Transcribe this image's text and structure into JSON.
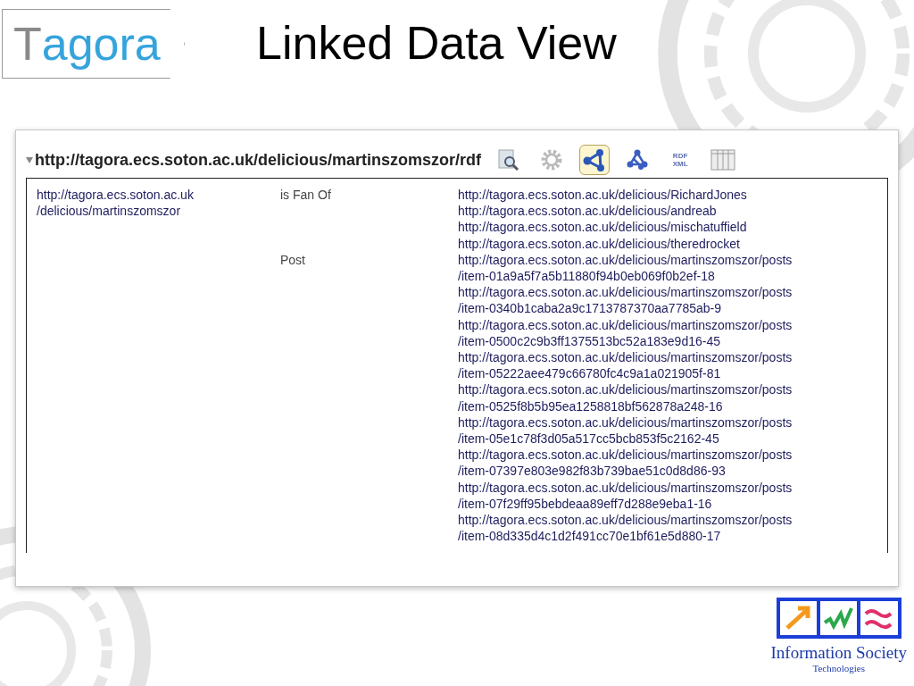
{
  "logo": {
    "text": "Tagora"
  },
  "title": "Linked Data View",
  "panel": {
    "expanded": true,
    "url": "http://tagora.ecs.soton.ac.uk/delicious/martinszomszor/rdf",
    "tools": [
      {
        "kind": "search",
        "selected": false
      },
      {
        "kind": "gear",
        "selected": false
      },
      {
        "kind": "graph",
        "selected": true
      },
      {
        "kind": "network",
        "selected": false
      },
      {
        "kind": "rdf",
        "label": "RDF\nXML",
        "selected": false
      },
      {
        "kind": "table",
        "selected": false
      }
    ],
    "subject": "http://tagora.ecs.soton.ac.uk\n/delicious/martinszomszor",
    "properties": [
      {
        "label": "is Fan Of",
        "values": [
          "http://tagora.ecs.soton.ac.uk/delicious/RichardJones",
          "http://tagora.ecs.soton.ac.uk/delicious/andreab",
          "http://tagora.ecs.soton.ac.uk/delicious/mischatuffield",
          "http://tagora.ecs.soton.ac.uk/delicious/theredrocket"
        ]
      },
      {
        "label": "Post",
        "values": [
          "http://tagora.ecs.soton.ac.uk/delicious/martinszomszor/posts\n/item-01a9a5f7a5b11880f94b0eb069f0b2ef-18",
          "http://tagora.ecs.soton.ac.uk/delicious/martinszomszor/posts\n/item-0340b1caba2a9c1713787370aa7785ab-9",
          "http://tagora.ecs.soton.ac.uk/delicious/martinszomszor/posts\n/item-0500c2c9b3ff1375513bc52a183e9d16-45",
          "http://tagora.ecs.soton.ac.uk/delicious/martinszomszor/posts\n/item-05222aee479c66780fc4c9a1a021905f-81",
          "http://tagora.ecs.soton.ac.uk/delicious/martinszomszor/posts\n/item-0525f8b5b95ea1258818bf562878a248-16",
          "http://tagora.ecs.soton.ac.uk/delicious/martinszomszor/posts\n/item-05e1c78f3d05a517cc5bcb853f5c2162-45",
          "http://tagora.ecs.soton.ac.uk/delicious/martinszomszor/posts\n/item-07397e803e982f83b739bae51c0d8d86-93",
          "http://tagora.ecs.soton.ac.uk/delicious/martinszomszor/posts\n/item-07f29ff95bebdeaa89eff7d288e9eba1-16",
          "http://tagora.ecs.soton.ac.uk/delicious/martinszomszor/posts\n/item-08d335d4c1d2f491cc70e1bf61e5d880-17"
        ]
      }
    ]
  },
  "footer_logo": {
    "name": "Information Society",
    "subtitle": "Technologies"
  }
}
